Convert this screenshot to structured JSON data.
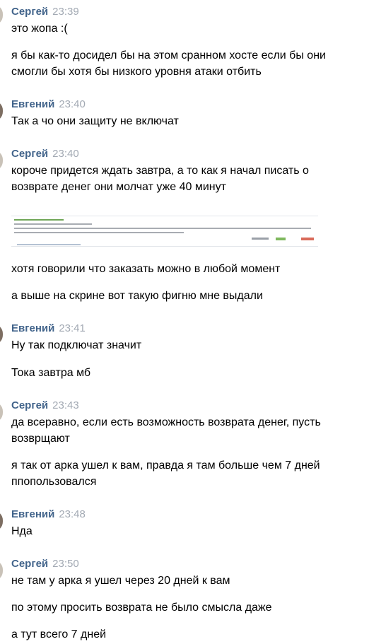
{
  "messages": [
    {
      "author": "Сергей",
      "time": "23:39",
      "lines": [
        "это жопа :(",
        "я бы как-то досидел бы на этом сранном хосте если бы они",
        "смогли бы хотя бы низкого уровня атаки отбить"
      ]
    },
    {
      "author": "Евгений",
      "time": "23:40",
      "lines": [
        "Так а чо они защиту не включат"
      ]
    },
    {
      "author": "Сергей",
      "time": "23:40",
      "lines": [
        "короче придется ждать завтра, а то как я начал писать о",
        "возврате денег они молчат уже 40 минут",
        "хотя говорили что заказать можно в любой момент",
        "а выше на скрине вот такую фигню мне выдали"
      ]
    },
    {
      "author": "Евгений",
      "time": "23:41",
      "lines": [
        "Ну так подключат значит",
        "Тока завтра мб"
      ]
    },
    {
      "author": "Сергей",
      "time": "23:43",
      "lines": [
        "да всеравно, если есть возможность возврата денег, пусть",
        "возврщают",
        "я так от арка ушел к вам, правда я там больше чем 7 дней",
        "ппопользовался"
      ]
    },
    {
      "author": "Евгений",
      "time": "23:48",
      "lines": [
        "Нда"
      ]
    },
    {
      "author": "Сергей",
      "time": "23:50",
      "lines": [
        "не там у арка я ушел через 20 дней к вам",
        "по этому просить возврата не было смысла даже",
        "а тут всего 7 дней"
      ]
    }
  ]
}
